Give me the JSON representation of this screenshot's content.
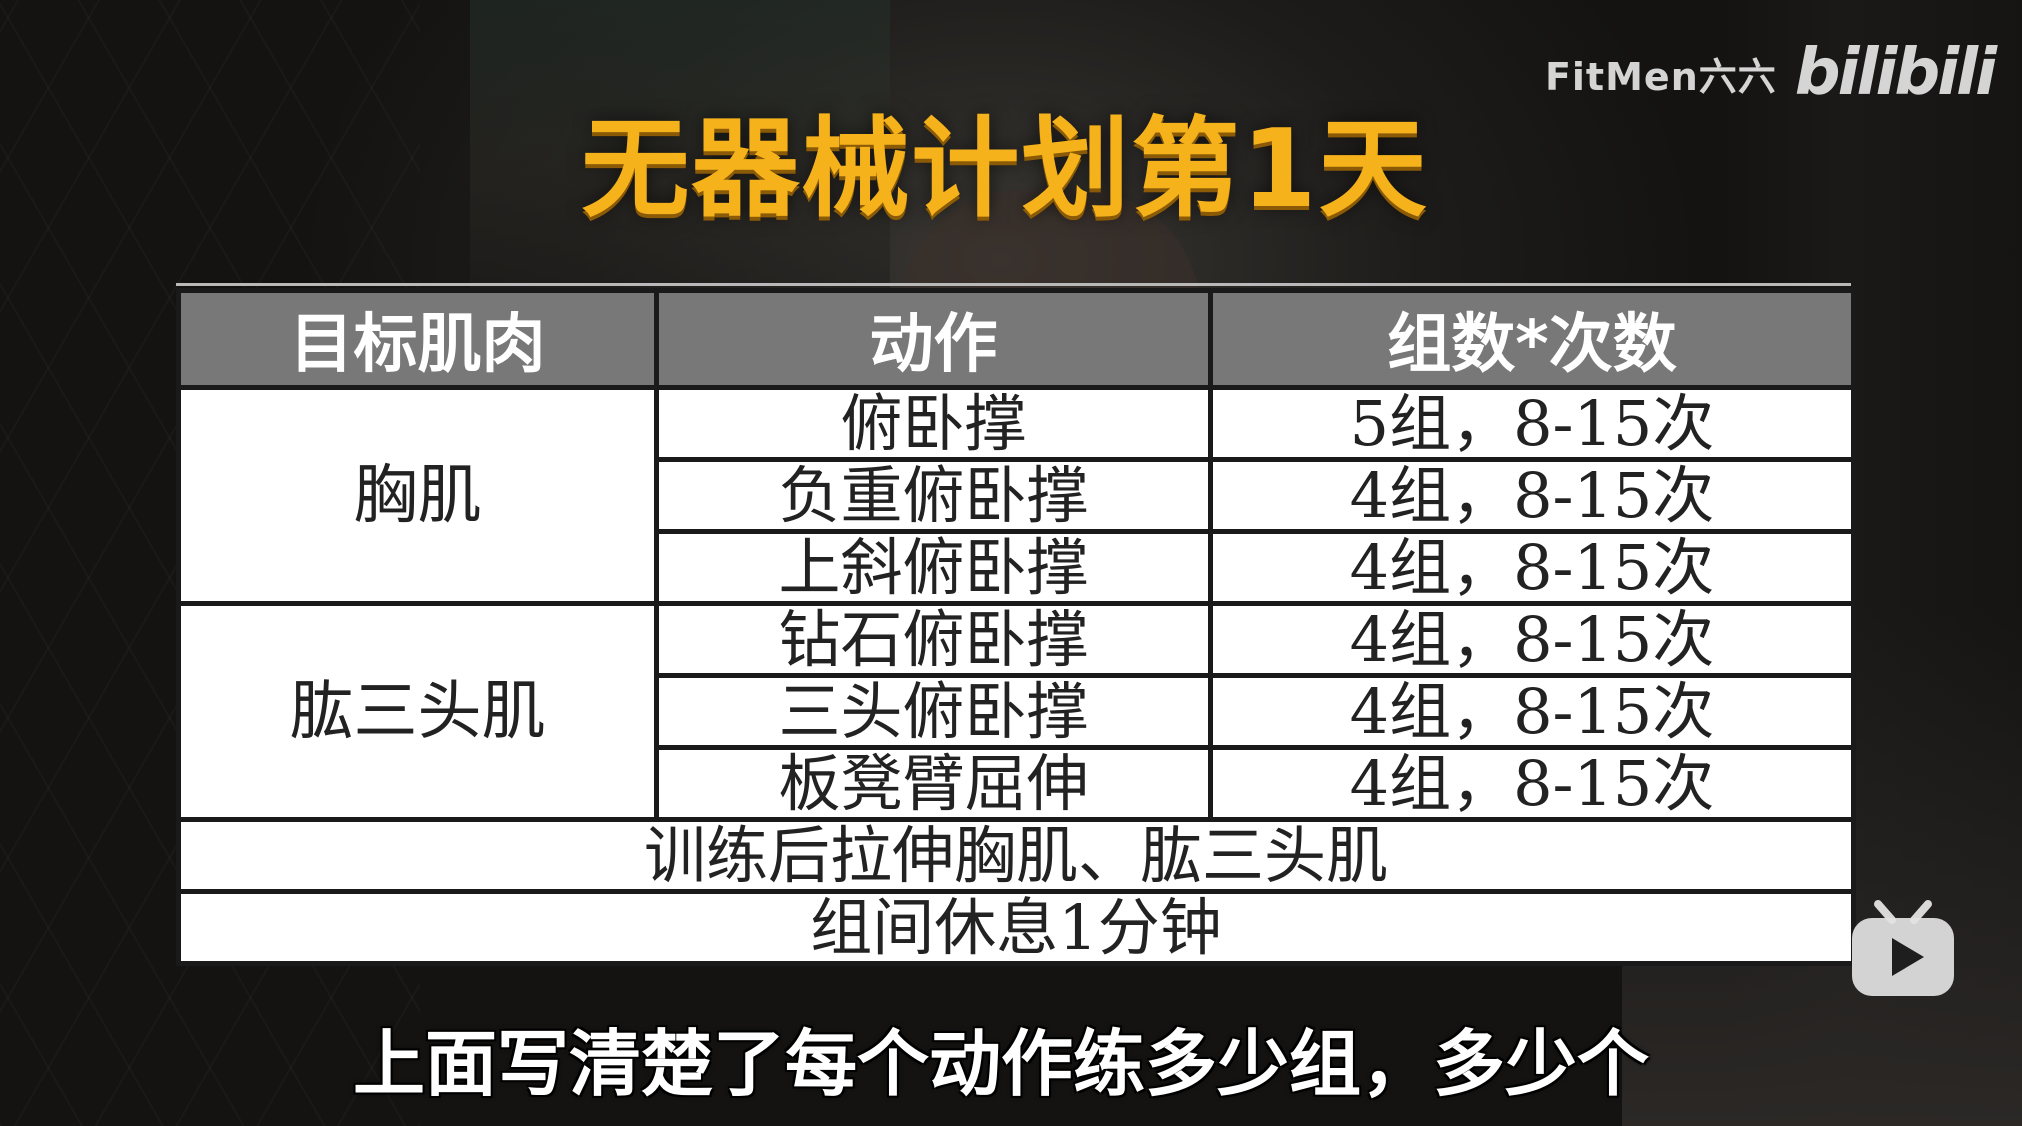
{
  "watermark": {
    "author": "FitMen六六",
    "platform": "bilibili"
  },
  "title": "无器械计划第1天",
  "table": {
    "headers": [
      "目标肌肉",
      "动作",
      "组数*次数"
    ],
    "groups": [
      {
        "muscle": "胸肌",
        "rows": [
          {
            "exercise": "俯卧撑",
            "sets": "5组，8-15次"
          },
          {
            "exercise": "负重俯卧撑",
            "sets": "4组，8-15次"
          },
          {
            "exercise": "上斜俯卧撑",
            "sets": "4组，8-15次"
          }
        ]
      },
      {
        "muscle": "肱三头肌",
        "rows": [
          {
            "exercise": "钻石俯卧撑",
            "sets": "4组，8-15次"
          },
          {
            "exercise": "三头俯卧撑",
            "sets": "4组，8-15次"
          },
          {
            "exercise": "板凳臂屈伸",
            "sets": "4组，8-15次"
          }
        ]
      }
    ],
    "notes": [
      "训练后拉伸胸肌、肱三头肌",
      "组间休息1分钟"
    ]
  },
  "subtitle": "上面写清楚了每个动作练多少组，多少个",
  "colors": {
    "title": "#f6b21b",
    "header_bg": "#787878",
    "cell_bg": "#ffffff",
    "border": "#1a1a1a"
  },
  "icons": [
    "tv-play-icon"
  ]
}
